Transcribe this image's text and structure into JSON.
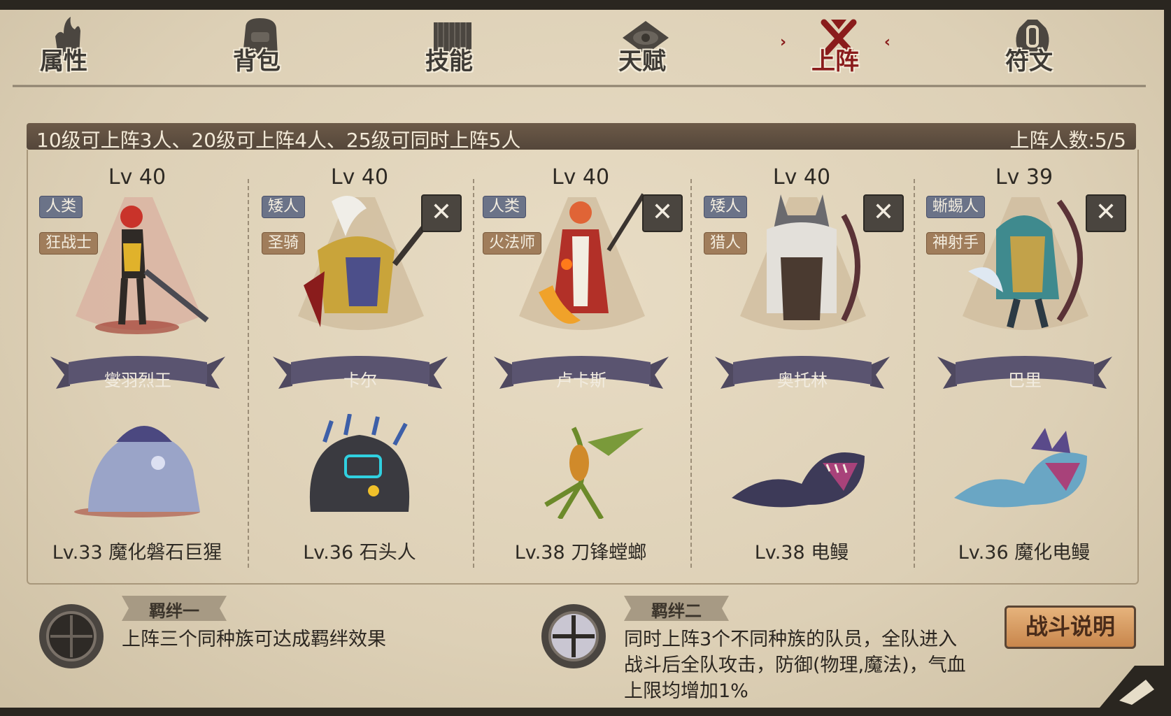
{
  "tabs": [
    {
      "label": "属性",
      "icon": "fist-flame-icon"
    },
    {
      "label": "背包",
      "icon": "backpack-icon"
    },
    {
      "label": "技能",
      "icon": "spellbook-icon"
    },
    {
      "label": "天赋",
      "icon": "eye-swirl-icon"
    },
    {
      "label": "上阵",
      "icon": "crossed-swords-icon",
      "active": true
    },
    {
      "label": "符文",
      "icon": "rune-icon"
    }
  ],
  "banner": {
    "info": "10级可上阵3人、20级可上阵4人、25级可同时上阵5人",
    "count": "上阵人数:5/5"
  },
  "heroes": [
    {
      "level": "Lv 40",
      "race": "人类",
      "cls": "狂战士",
      "name": "燮羽烈王",
      "pet": "Lv.33 魔化磐石巨猩",
      "removable": false
    },
    {
      "level": "Lv 40",
      "race": "矮人",
      "cls": "圣骑",
      "name": "卡尔",
      "pet": "Lv.36 石头人",
      "removable": true
    },
    {
      "level": "Lv 40",
      "race": "人类",
      "cls": "火法师",
      "name": "卢卡斯",
      "pet": "Lv.38 刀锋螳螂",
      "removable": true
    },
    {
      "level": "Lv 40",
      "race": "矮人",
      "cls": "猎人",
      "name": "奥托林",
      "pet": "Lv.38 电鳗",
      "removable": true
    },
    {
      "level": "Lv 39",
      "race": "蜥蜴人",
      "cls": "神射手",
      "name": "巴里",
      "pet": "Lv.36 魔化电鳗",
      "removable": true
    }
  ],
  "remove_label": "✕",
  "bonds": [
    {
      "title": "羁绊一",
      "lines": [
        "上阵三个同种族可达成羁绊效果"
      ]
    },
    {
      "title": "羁绊二",
      "lines": [
        "同时上阵3个不同种族的队员，全队进入",
        "战斗后全队攻击，防御(物理,魔法)，气血",
        "上限均增加1%"
      ]
    }
  ],
  "battle_button": "战斗说明",
  "colors": {
    "active_tab": "#8a1c1c",
    "banner": "#5e4f40",
    "parchment": "#e2d6bd"
  }
}
